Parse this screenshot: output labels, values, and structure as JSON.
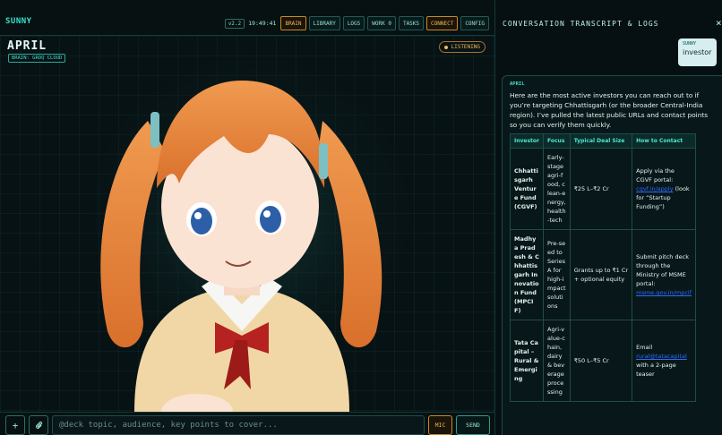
{
  "app": {
    "brand": "SUNNY",
    "version": "v2.2",
    "clock": "19:49:41",
    "tabs": [
      {
        "label": "BRAIN",
        "active": true
      },
      {
        "label": "LIBRARY",
        "active": false
      },
      {
        "label": "LOGS",
        "active": false
      },
      {
        "label": "WORK 0",
        "active": false
      },
      {
        "label": "TASKS",
        "active": false
      },
      {
        "label": "CONNECT",
        "active": true
      },
      {
        "label": "CONFIG",
        "active": false
      }
    ]
  },
  "stage": {
    "name": "APRIL",
    "brain": "BRAIN: GROQ CLOUD",
    "status": "LISTENING"
  },
  "input": {
    "add": "+",
    "placeholder": "@deck topic, audience, key points to cover...",
    "mic": "MIC",
    "send": "SEND"
  },
  "panel": {
    "title": "CONVERSATION TRANSCRIPT & LOGS",
    "close": "×",
    "user_msg": {
      "sender": "SUNNY",
      "text": "investor"
    },
    "bot_msg": {
      "sender": "APRIL",
      "intro": "Here are the most active investors you can reach out to if you’re targeting Chhattisgarh (or the broader Central-India region). I’ve pulled the latest public URLs and contact points so you can verify them quickly.",
      "table": {
        "headers": [
          "Investor",
          "Focus",
          "Typical Deal Size",
          "How to Contact"
        ],
        "rows": [
          {
            "investor": "Chhattisgarh Venture Fund (CGVF)",
            "focus": "Early-stage agri-food, clean-energy, health-tech",
            "deal": "₹25 L–₹2 Cr",
            "how_pre": "Apply via the CGVF portal:",
            "how_link": "cgvf.in/apply",
            "how_post": "(look for “Startup Funding”)"
          },
          {
            "investor": "Madhya Pradesh & Chhattisgarh Innovation Fund (MPCIF)",
            "focus": "Pre-seed to Series A for high-impact solutions",
            "deal": "Grants up to ₹1 Cr + optional equity",
            "how_pre": "Submit pitch deck through the Ministry of MSME portal:",
            "how_link": "msme.gov.in/mpcif",
            "how_post": ""
          },
          {
            "investor": "Tata Capital – Rural & Emerging",
            "focus": "Agri-value-chain, dairy & beverage processing",
            "deal": "₹50 L–₹5 Cr",
            "how_pre": "Email",
            "how_link": "rural@tatacapital",
            "how_post": "with a 2-page teaser"
          }
        ]
      }
    }
  },
  "colors": {
    "accent": "#39e0c9",
    "amber": "#f0b75a",
    "bg": "#050b0c"
  },
  "icons": {
    "attach": "paperclip-icon",
    "add": "plus-icon",
    "close": "close-icon",
    "status": "listening-dot-icon"
  }
}
